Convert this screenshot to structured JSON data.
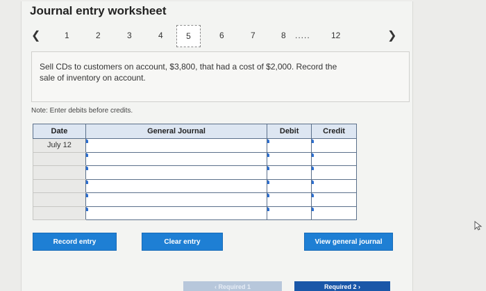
{
  "title": "Journal entry worksheet",
  "pager": {
    "prev_icon": "chevron-left-icon",
    "next_icon": "chevron-right-icon",
    "pages": [
      "1",
      "2",
      "3",
      "4",
      "5",
      "6",
      "7",
      "8"
    ],
    "current": "5",
    "ellipsis": ".....",
    "last": "12"
  },
  "description": "Sell CDs to customers on account, $3,800, that had a cost of $2,000. Record the sale of inventory on account.",
  "note": "Note: Enter debits before credits.",
  "journal": {
    "headers": [
      "Date",
      "General Journal",
      "Debit",
      "Credit"
    ],
    "rows": [
      {
        "date": "July 12",
        "account": "",
        "debit": "",
        "credit": ""
      },
      {
        "date": "",
        "account": "",
        "debit": "",
        "credit": ""
      },
      {
        "date": "",
        "account": "",
        "debit": "",
        "credit": ""
      },
      {
        "date": "",
        "account": "",
        "debit": "",
        "credit": ""
      },
      {
        "date": "",
        "account": "",
        "debit": "",
        "credit": ""
      },
      {
        "date": "",
        "account": "",
        "debit": "",
        "credit": ""
      }
    ]
  },
  "buttons": {
    "record": "Record entry",
    "clear": "Clear entry",
    "view": "View general journal"
  },
  "nav": {
    "prev": "Required 1",
    "next": "Required 2"
  },
  "colors": {
    "button_blue": "#1e7fd4",
    "header_bg": "#dde6f2",
    "nav_blue": "#1a57a8"
  }
}
